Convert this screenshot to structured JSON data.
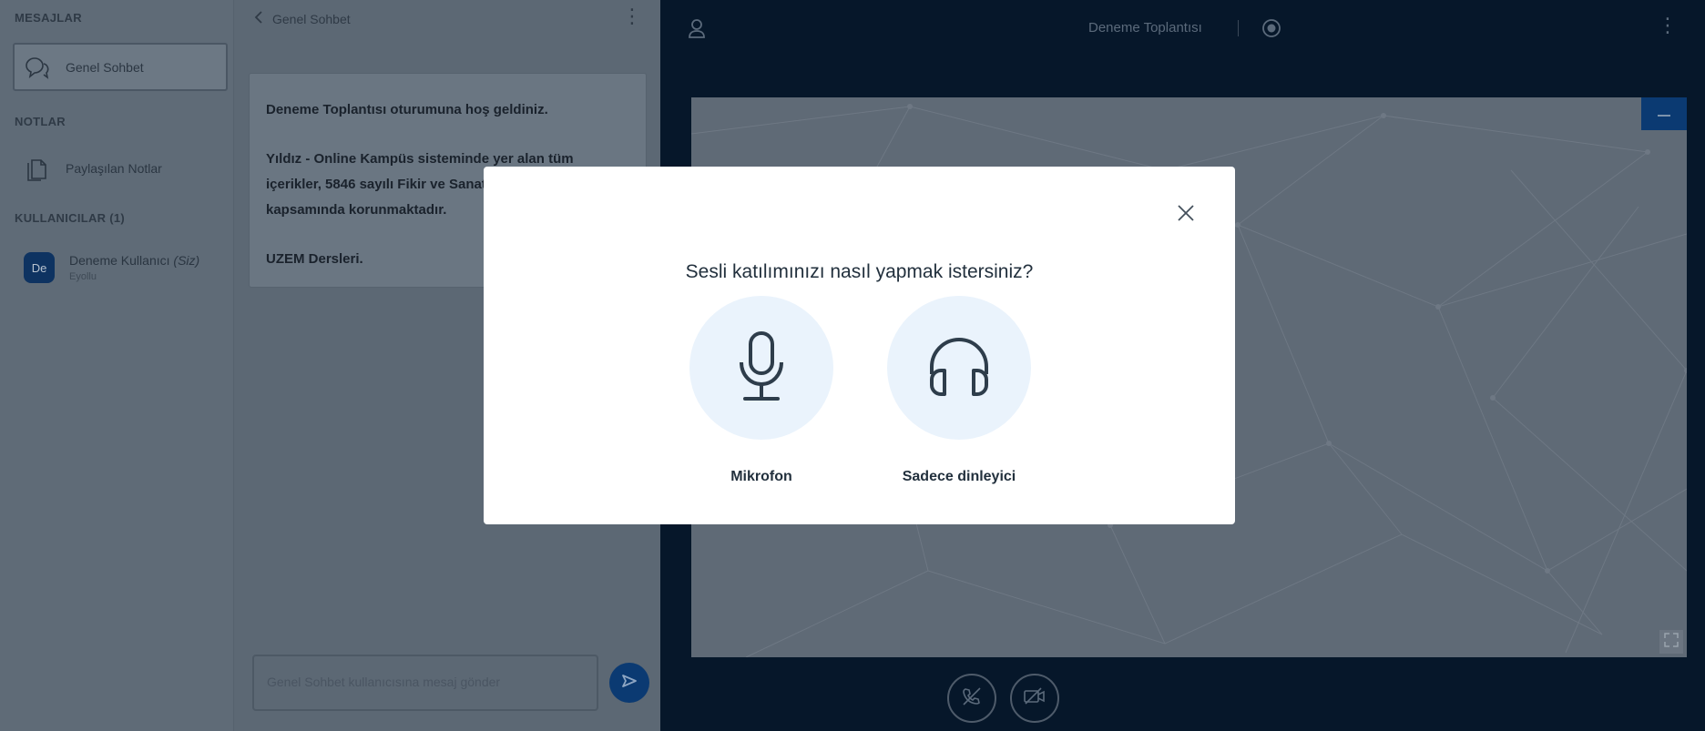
{
  "userlist": {
    "messages_heading": "MESAJLAR",
    "public_chat_label": "Genel Sohbet",
    "notes_heading": "NOTLAR",
    "shared_notes_label": "Paylaşılan Notlar",
    "users_heading": "KULLANICILAR (1)",
    "user": {
      "avatar_initials": "De",
      "name": "Deneme Kullanıcı",
      "you_suffix": "(Siz)",
      "status": "Eyollu"
    }
  },
  "chat": {
    "back_label": "Genel Sohbet",
    "welcome_line1": "Deneme Toplantısı oturumuna hoş geldiniz.",
    "welcome_line2": "Yıldız - Online Kampüs sisteminde yer alan tüm içerikler, 5846 sayılı Fikir ve Sanat Eserleri Kanunu kapsamında korunmaktadır.",
    "welcome_line3": "UZEM Dersleri.",
    "input_placeholder": "Genel Sohbet kullanıcısına mesaj gönder"
  },
  "topbar": {
    "meeting_title": "Deneme Toplantısı"
  },
  "modal": {
    "title": "Sesli katılımınızı nasıl yapmak istersiniz?",
    "microphone_label": "Mikrofon",
    "listen_only_label": "Sadece dinleyici"
  },
  "icons": {
    "public_chat": "chat-bubbles-icon",
    "shared_notes": "document-icon",
    "user": "user-icon",
    "record": "record-icon",
    "microphone": "microphone-icon",
    "headphones": "headphones-icon",
    "close": "close-icon",
    "send": "send-icon",
    "audio_off": "phone-off-icon",
    "video_off": "video-off-icon"
  },
  "colors": {
    "brand_blue": "#0b3a72",
    "topbar": "#06172a",
    "modal_option_bg": "#eaf3fc"
  }
}
